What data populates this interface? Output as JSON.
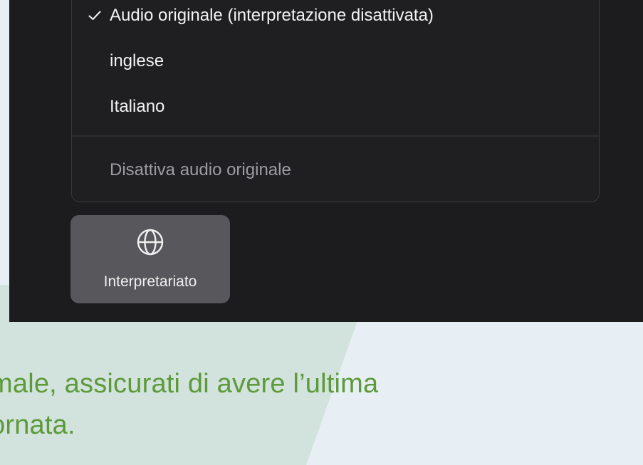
{
  "menu": {
    "items": [
      {
        "label": "Audio originale (interpretazione disattivata)",
        "checked": true
      },
      {
        "label": "inglese",
        "checked": false
      },
      {
        "label": "Italiano",
        "checked": false
      }
    ],
    "footer_item": {
      "label": "Disattiva audio originale"
    }
  },
  "toolbar": {
    "interpretation_button": {
      "label": "Interpretariato",
      "icon": "globe-icon"
    }
  },
  "caption": {
    "line1": "male, assicurati di avere l’ultima",
    "line2": "ornata."
  },
  "colors": {
    "panel_bg": "#1c1c1f",
    "button_bg": "#58585c",
    "caption_text": "#5c9a3a",
    "page_bg": "#e7eef4",
    "shape_bg": "#d2e2dc"
  }
}
